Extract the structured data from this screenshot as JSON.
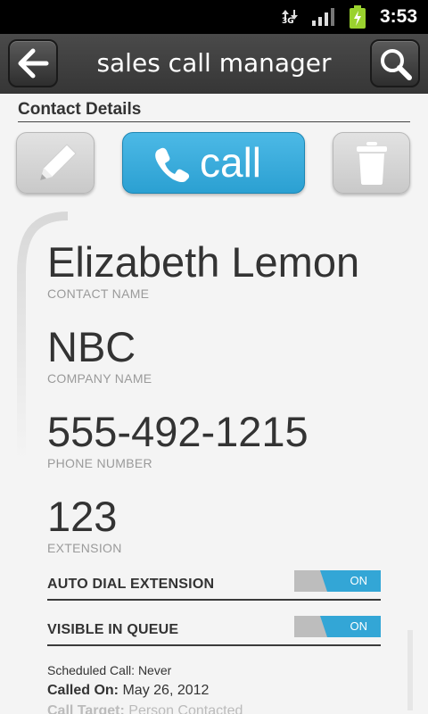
{
  "status_bar": {
    "network": "3G",
    "time": "3:53"
  },
  "title_bar": {
    "title": "sales call manager"
  },
  "section": {
    "heading": "Contact Details"
  },
  "actions": {
    "call_label": "call"
  },
  "contact": {
    "name": {
      "value": "Elizabeth Lemon",
      "label": "CONTACT NAME"
    },
    "company": {
      "value": "NBC",
      "label": "COMPANY NAME"
    },
    "phone": {
      "value": "555-492-1215",
      "label": "PHONE NUMBER"
    },
    "extension": {
      "value": "123",
      "label": "EXTENSION"
    }
  },
  "toggles": {
    "auto_dial": {
      "label": "AUTO DIAL EXTENSION",
      "state": "ON"
    },
    "visible_queue": {
      "label": "VISIBLE IN QUEUE",
      "state": "ON"
    }
  },
  "info": {
    "scheduled": "Scheduled Call: Never",
    "called_label": "Called On:",
    "called_value": "May 26, 2012",
    "target_label": "Call Target:",
    "target_value": "Person Contacted"
  },
  "colors": {
    "accent": "#33a6d6",
    "title_bar": "#404040",
    "background": "#f4f4f4"
  }
}
